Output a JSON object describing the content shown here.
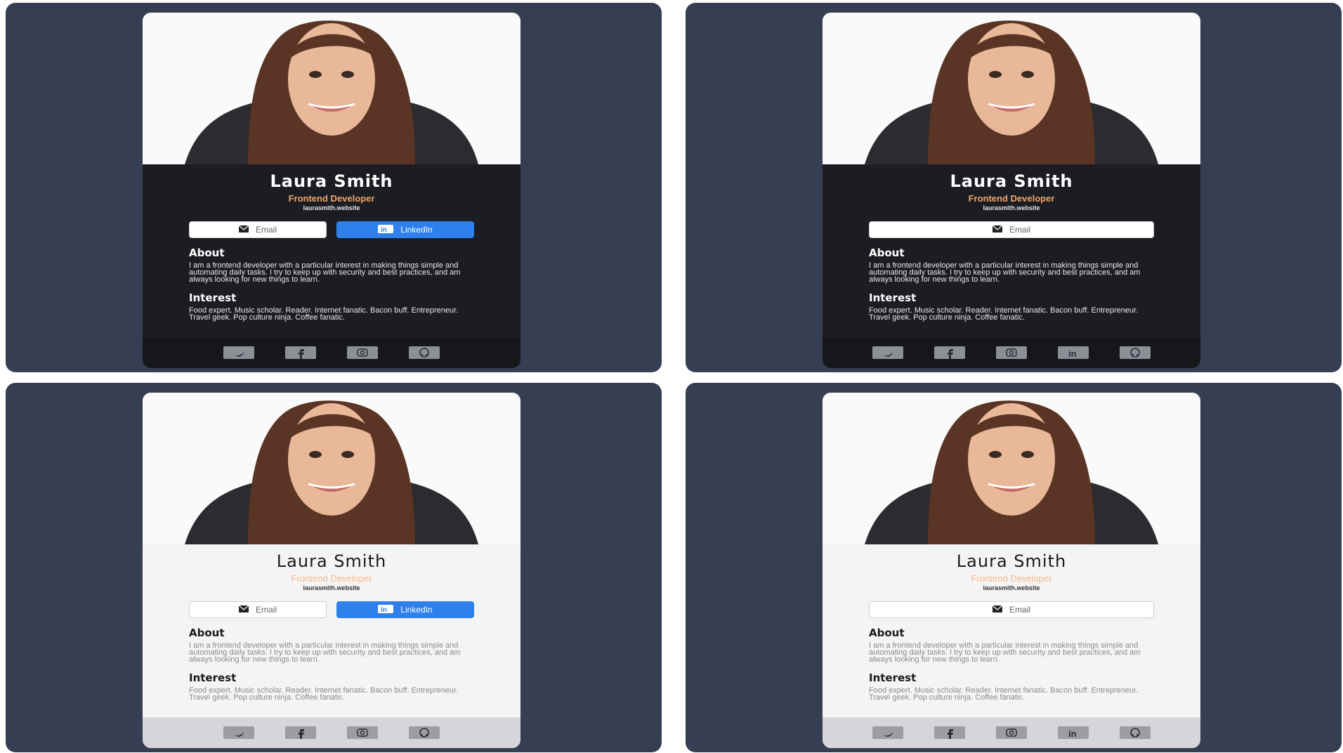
{
  "cards": [
    {
      "theme": "dark",
      "variant": "with-linkedin"
    },
    {
      "theme": "dark",
      "variant": "email-only"
    },
    {
      "theme": "light",
      "variant": "with-linkedin"
    },
    {
      "theme": "light",
      "variant": "email-only"
    }
  ],
  "profile": {
    "name": "Laura Smith",
    "role": "Frontend Developer",
    "website": "laurasmith.website",
    "email_label": "Email",
    "linkedin_label": "LinkedIn",
    "about_heading": "About",
    "about_text": "I am a frontend developer with a particular interest in making things simple and automating daily tasks. I try to keep up with security and best practices, and am always looking for new things to learn.",
    "interest_heading": "Interest",
    "interest_text": "Food expert. Music scholar. Reader. Internet fanatic. Bacon buff. Entrepreneur. Travel geek. Pop culture ninja. Coffee fanatic."
  },
  "social_icons": [
    "twitter-icon",
    "facebook-icon",
    "instagram-icon",
    "linkedin-icon",
    "github-icon"
  ],
  "colors": {
    "page_bg": "#363f51",
    "dark_card": "#1b1d22",
    "light_card": "#f4f4f4",
    "accent_orange": "#f3a46a",
    "linkedin_blue": "#2f80ed"
  }
}
